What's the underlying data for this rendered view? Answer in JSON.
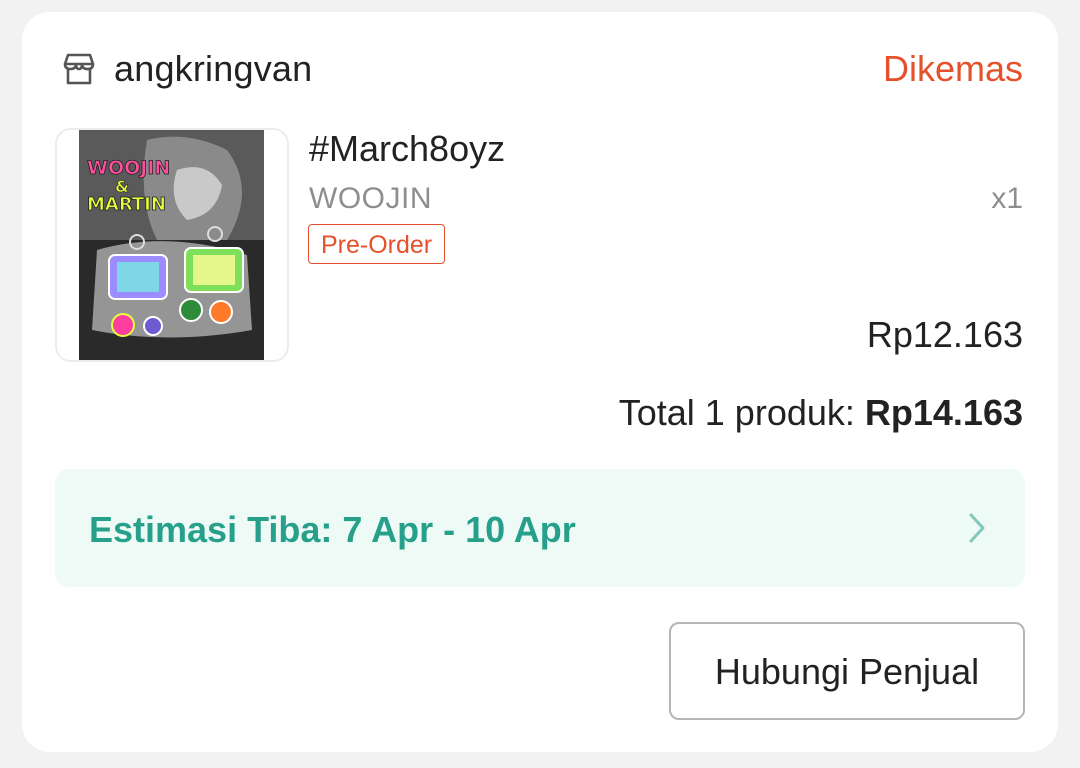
{
  "order": {
    "shop_name": "angkringvan",
    "status": "Dikemas",
    "item": {
      "title": "#March8oyz",
      "variant": "WOOJIN",
      "badge": "Pre-Order",
      "quantity": "x1",
      "price": "Rp12.163",
      "image_texts": {
        "line1": "WOOJIN",
        "amp": "&",
        "line2": "MARTIN"
      }
    },
    "total": {
      "label": "Total 1 produk: ",
      "amount": "Rp14.163"
    },
    "estimate": {
      "label": "Estimasi Tiba: 7 Apr - 10 Apr",
      "icon": "chevron-right-icon"
    },
    "contact_button": "Hubungi Penjual"
  },
  "icons": {
    "shop": "store-icon",
    "chevron": "chevron-right-icon"
  },
  "colors": {
    "accent": "#e4512a",
    "estimate_text": "#26a08a",
    "estimate_bg": "#eefaf6",
    "text": "#222222",
    "muted": "#8e8e8e"
  }
}
